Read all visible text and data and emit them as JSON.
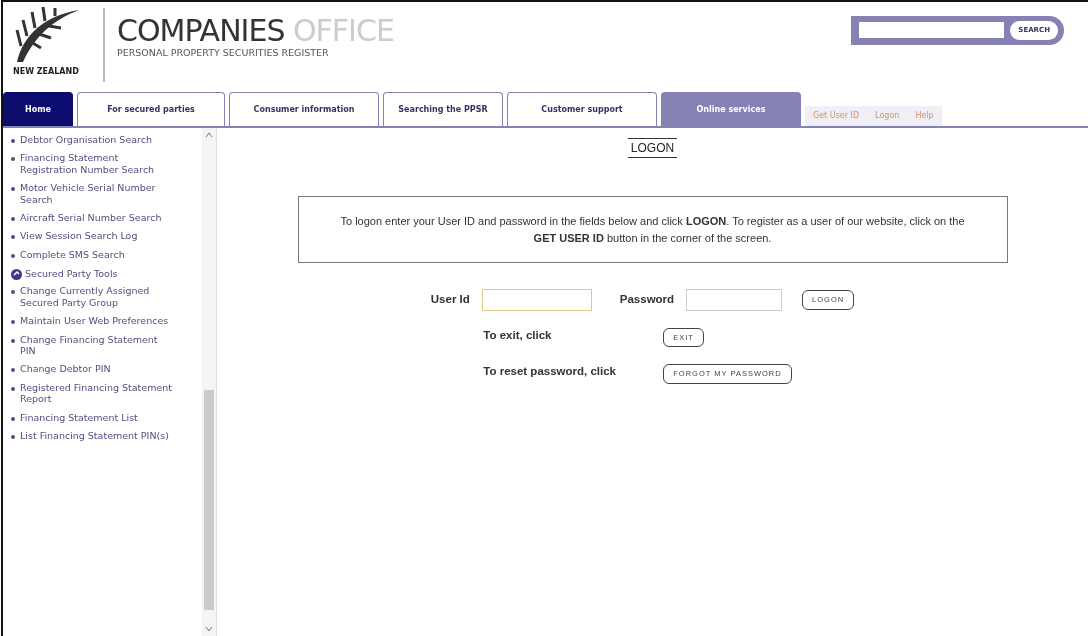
{
  "header": {
    "country": "NEW ZEALAND",
    "title_main": "COMPANIES",
    "title_light": "OFFICE",
    "subtitle": "PERSONAL PROPERTY SECURITIES REGISTER",
    "search_button": "SEARCH"
  },
  "tabs": [
    {
      "label": "Home",
      "selected": true,
      "highlighted": false
    },
    {
      "label": "For secured parties",
      "selected": false,
      "highlighted": false
    },
    {
      "label": "Consumer information",
      "selected": false,
      "highlighted": false
    },
    {
      "label": "Searching the PPSR",
      "selected": false,
      "highlighted": false
    },
    {
      "label": "Customer support",
      "selected": false,
      "highlighted": false
    },
    {
      "label": "Online services",
      "selected": false,
      "highlighted": true
    }
  ],
  "utility_links": [
    "Get User ID",
    "Logon",
    "Help"
  ],
  "sidebar": {
    "items": [
      {
        "kind": "link",
        "label": "Debtor Organisation Search"
      },
      {
        "kind": "link",
        "label": "Financing Statement Registration Number Search"
      },
      {
        "kind": "link",
        "label": "Motor Vehicle Serial Number Search"
      },
      {
        "kind": "link",
        "label": "Aircraft Serial Number Search"
      },
      {
        "kind": "link",
        "label": "View Session Search Log"
      },
      {
        "kind": "link",
        "label": "Complete SMS Search"
      },
      {
        "kind": "section",
        "label": "Secured Party Tools"
      },
      {
        "kind": "link",
        "label": "Change Currently Assigned Secured Party Group"
      },
      {
        "kind": "link",
        "label": "Maintain User Web Preferences"
      },
      {
        "kind": "link",
        "label": "Change Financing Statement PIN"
      },
      {
        "kind": "link",
        "label": "Change Debtor PIN"
      },
      {
        "kind": "link",
        "label": "Registered Financing Statement Report"
      },
      {
        "kind": "link",
        "label": "Financing Statement List"
      },
      {
        "kind": "link",
        "label": "List Financing Statement PIN(s)"
      }
    ]
  },
  "main": {
    "heading": "LOGON",
    "instructions": "To logon enter your User ID and password in the fields below and click **LOGON**. To register as a user of our website, click on the **GET USER ID** button in the corner of the screen.",
    "user_id_label": "User Id",
    "password_label": "Password",
    "logon_button": "LOGON",
    "exit_label": "To exit, click",
    "exit_button": "EXIT",
    "reset_label": "To reset password, click",
    "reset_button": "FORGOT MY PASSWORD"
  }
}
